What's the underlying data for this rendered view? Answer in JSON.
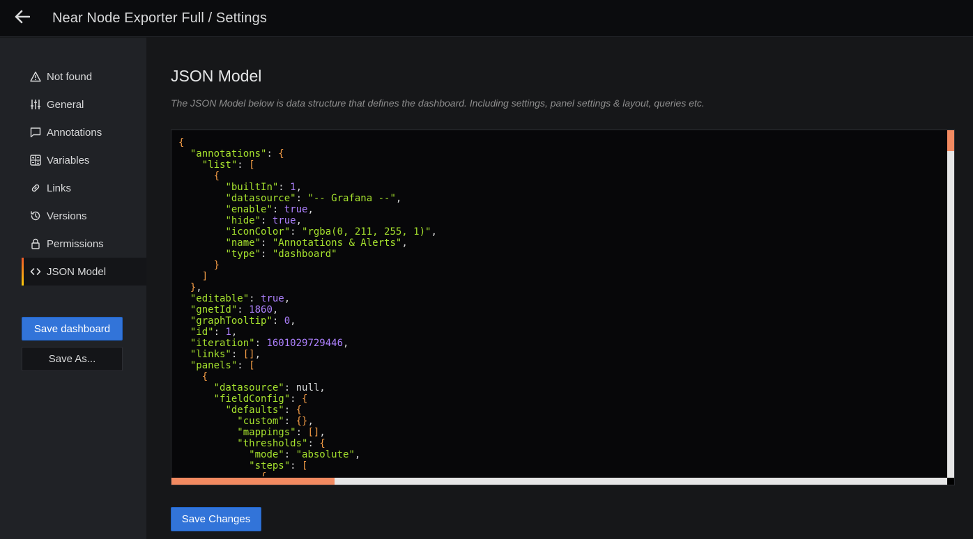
{
  "header": {
    "title": "Near Node Exporter Full / Settings",
    "back_icon": "arrow-left-icon"
  },
  "sidebar": {
    "items": [
      {
        "label": "Not found",
        "icon": "warning-triangle-icon"
      },
      {
        "label": "General",
        "icon": "sliders-icon"
      },
      {
        "label": "Annotations",
        "icon": "comment-icon"
      },
      {
        "label": "Variables",
        "icon": "calculator-icon"
      },
      {
        "label": "Links",
        "icon": "link-icon"
      },
      {
        "label": "Versions",
        "icon": "history-icon"
      },
      {
        "label": "Permissions",
        "icon": "lock-icon"
      },
      {
        "label": "JSON Model",
        "icon": "code-brackets-icon",
        "active": true
      }
    ],
    "save_dashboard_label": "Save dashboard",
    "save_as_label": "Save As..."
  },
  "main": {
    "title": "JSON Model",
    "description": "The JSON Model below is data structure that defines the dashboard. Including settings, panel settings & layout, queries etc.",
    "save_changes_label": "Save Changes"
  },
  "editor": {
    "lines": [
      [
        [
          "p",
          "{"
        ]
      ],
      [
        [
          "t",
          "  "
        ],
        [
          "k",
          "\"annotations\""
        ],
        [
          "t",
          ": "
        ],
        [
          "p",
          "{"
        ]
      ],
      [
        [
          "t",
          "    "
        ],
        [
          "k",
          "\"list\""
        ],
        [
          "t",
          ": "
        ],
        [
          "p",
          "["
        ]
      ],
      [
        [
          "t",
          "      "
        ],
        [
          "p",
          "{"
        ]
      ],
      [
        [
          "t",
          "        "
        ],
        [
          "k",
          "\"builtIn\""
        ],
        [
          "t",
          ": "
        ],
        [
          "n",
          "1"
        ],
        [
          "t",
          ","
        ]
      ],
      [
        [
          "t",
          "        "
        ],
        [
          "k",
          "\"datasource\""
        ],
        [
          "t",
          ": "
        ],
        [
          "s",
          "\"-- Grafana --\""
        ],
        [
          "t",
          ","
        ]
      ],
      [
        [
          "t",
          "        "
        ],
        [
          "k",
          "\"enable\""
        ],
        [
          "t",
          ": "
        ],
        [
          "b",
          "true"
        ],
        [
          "t",
          ","
        ]
      ],
      [
        [
          "t",
          "        "
        ],
        [
          "k",
          "\"hide\""
        ],
        [
          "t",
          ": "
        ],
        [
          "b",
          "true"
        ],
        [
          "t",
          ","
        ]
      ],
      [
        [
          "t",
          "        "
        ],
        [
          "k",
          "\"iconColor\""
        ],
        [
          "t",
          ": "
        ],
        [
          "s",
          "\"rgba(0, 211, 255, 1)\""
        ],
        [
          "t",
          ","
        ]
      ],
      [
        [
          "t",
          "        "
        ],
        [
          "k",
          "\"name\""
        ],
        [
          "t",
          ": "
        ],
        [
          "s",
          "\"Annotations & Alerts\""
        ],
        [
          "t",
          ","
        ]
      ],
      [
        [
          "t",
          "        "
        ],
        [
          "k",
          "\"type\""
        ],
        [
          "t",
          ": "
        ],
        [
          "s",
          "\"dashboard\""
        ]
      ],
      [
        [
          "t",
          "      "
        ],
        [
          "p",
          "}"
        ]
      ],
      [
        [
          "t",
          "    "
        ],
        [
          "p",
          "]"
        ]
      ],
      [
        [
          "t",
          "  "
        ],
        [
          "p",
          "}"
        ],
        [
          "t",
          ","
        ]
      ],
      [
        [
          "t",
          "  "
        ],
        [
          "k",
          "\"editable\""
        ],
        [
          "t",
          ": "
        ],
        [
          "b",
          "true"
        ],
        [
          "t",
          ","
        ]
      ],
      [
        [
          "t",
          "  "
        ],
        [
          "k",
          "\"gnetId\""
        ],
        [
          "t",
          ": "
        ],
        [
          "n",
          "1860"
        ],
        [
          "t",
          ","
        ]
      ],
      [
        [
          "t",
          "  "
        ],
        [
          "k",
          "\"graphTooltip\""
        ],
        [
          "t",
          ": "
        ],
        [
          "n",
          "0"
        ],
        [
          "t",
          ","
        ]
      ],
      [
        [
          "t",
          "  "
        ],
        [
          "k",
          "\"id\""
        ],
        [
          "t",
          ": "
        ],
        [
          "n",
          "1"
        ],
        [
          "t",
          ","
        ]
      ],
      [
        [
          "t",
          "  "
        ],
        [
          "k",
          "\"iteration\""
        ],
        [
          "t",
          ": "
        ],
        [
          "n",
          "1601029729446"
        ],
        [
          "t",
          ","
        ]
      ],
      [
        [
          "t",
          "  "
        ],
        [
          "k",
          "\"links\""
        ],
        [
          "t",
          ": "
        ],
        [
          "p",
          "[]"
        ],
        [
          "t",
          ","
        ]
      ],
      [
        [
          "t",
          "  "
        ],
        [
          "k",
          "\"panels\""
        ],
        [
          "t",
          ": "
        ],
        [
          "p",
          "["
        ]
      ],
      [
        [
          "t",
          "    "
        ],
        [
          "p",
          "{"
        ]
      ],
      [
        [
          "t",
          "      "
        ],
        [
          "k",
          "\"datasource\""
        ],
        [
          "t",
          ": null,"
        ]
      ],
      [
        [
          "t",
          "      "
        ],
        [
          "k",
          "\"fieldConfig\""
        ],
        [
          "t",
          ": "
        ],
        [
          "p",
          "{"
        ]
      ],
      [
        [
          "t",
          "        "
        ],
        [
          "k",
          "\"defaults\""
        ],
        [
          "t",
          ": "
        ],
        [
          "p",
          "{"
        ]
      ],
      [
        [
          "t",
          "          "
        ],
        [
          "k",
          "\"custom\""
        ],
        [
          "t",
          ": "
        ],
        [
          "p",
          "{}"
        ],
        [
          "t",
          ","
        ]
      ],
      [
        [
          "t",
          "          "
        ],
        [
          "k",
          "\"mappings\""
        ],
        [
          "t",
          ": "
        ],
        [
          "p",
          "[]"
        ],
        [
          "t",
          ","
        ]
      ],
      [
        [
          "t",
          "          "
        ],
        [
          "k",
          "\"thresholds\""
        ],
        [
          "t",
          ": "
        ],
        [
          "p",
          "{"
        ]
      ],
      [
        [
          "t",
          "            "
        ],
        [
          "k",
          "\"mode\""
        ],
        [
          "t",
          ": "
        ],
        [
          "s",
          "\"absolute\""
        ],
        [
          "t",
          ","
        ]
      ],
      [
        [
          "t",
          "            "
        ],
        [
          "k",
          "\"steps\""
        ],
        [
          "t",
          ": "
        ],
        [
          "p",
          "["
        ]
      ],
      [
        [
          "t",
          "              "
        ],
        [
          "p",
          "{"
        ]
      ]
    ],
    "vertical_scroll_fraction": 0.06,
    "horizontal_scroll_fraction": 0.21
  }
}
